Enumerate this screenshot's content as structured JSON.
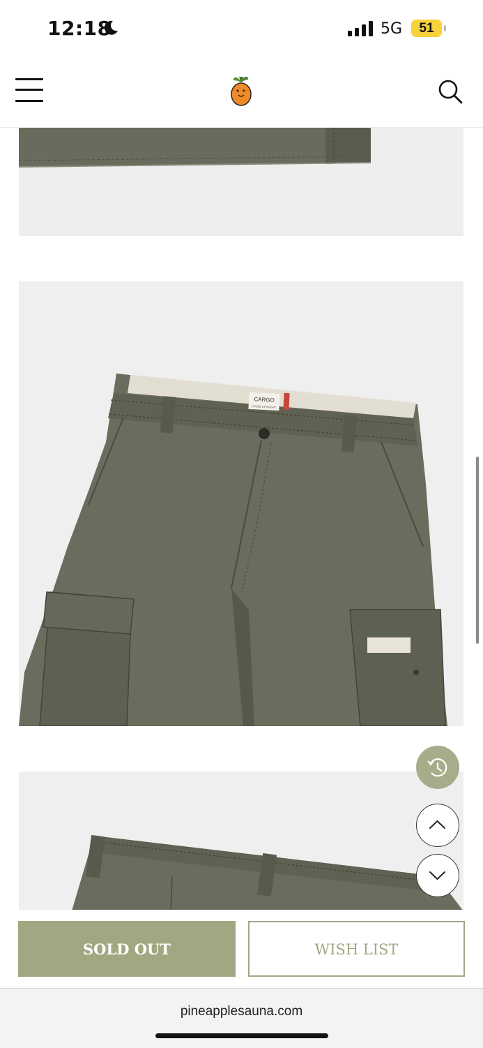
{
  "status_bar": {
    "time": "12:18",
    "network": "5G",
    "battery": "51",
    "icons": [
      "moon-icon",
      "signal-icon",
      "battery-icon"
    ]
  },
  "header": {
    "icons": [
      "hamburger-menu-icon",
      "pineapple-logo",
      "search-icon"
    ]
  },
  "gallery": {
    "images": [
      "pants-bottom-hem-photo",
      "cargo-pants-waist-photo",
      "cargo-pants-back-photo"
    ],
    "label_text": "CARGO",
    "label_subtext": "LOOSE STRAIGHT"
  },
  "floating_buttons": {
    "icons": [
      "clock-icon",
      "chevron-up-icon",
      "chevron-down-icon"
    ]
  },
  "actions": {
    "sold_out_label": "SOLD OUT",
    "wishlist_label": "WISH LIST"
  },
  "browser": {
    "url": "pineapplesauna.com"
  },
  "colors": {
    "accent": "#a0a882",
    "image_bg": "#efefef",
    "pants": "#686a5c"
  }
}
